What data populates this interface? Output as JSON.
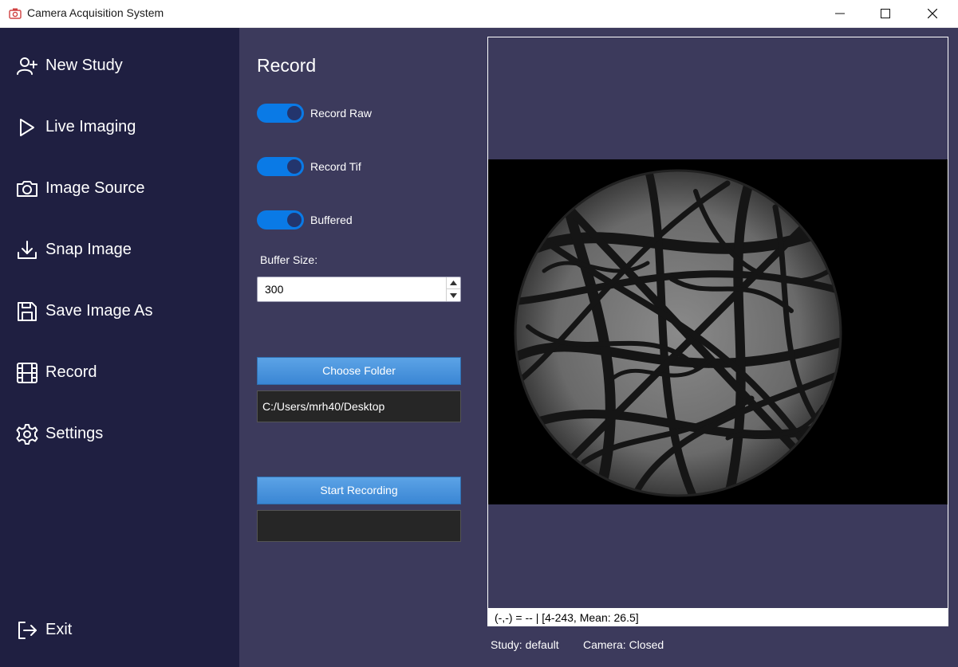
{
  "window": {
    "title": "Camera Acquisition System",
    "icon": "camera-app-icon"
  },
  "sidebar": {
    "items": [
      {
        "label": "New Study",
        "icon": "add-user-icon"
      },
      {
        "label": "Live Imaging",
        "icon": "play-icon"
      },
      {
        "label": "Image Source",
        "icon": "camera-icon"
      },
      {
        "label": "Snap Image",
        "icon": "download-icon"
      },
      {
        "label": "Save Image As",
        "icon": "save-icon"
      },
      {
        "label": "Record",
        "icon": "film-icon"
      },
      {
        "label": "Settings",
        "icon": "gear-icon"
      }
    ],
    "exit": {
      "label": "Exit",
      "icon": "exit-icon"
    }
  },
  "record_panel": {
    "title": "Record",
    "toggles": [
      {
        "label": "Record Raw",
        "on": true
      },
      {
        "label": "Record Tif",
        "on": true
      },
      {
        "label": "Buffered",
        "on": true
      }
    ],
    "buffer_size_label": "Buffer Size:",
    "buffer_size_value": "300",
    "choose_folder_label": "Choose Folder",
    "folder_path": "C:/Users/mrh40/Desktop",
    "start_recording_label": "Start Recording",
    "recording_status": ""
  },
  "viewer": {
    "status_line": "(-,-) = -- | [4-243, Mean: 26.5]",
    "study": "Study: default",
    "camera": "Camera: Closed"
  },
  "colors": {
    "sidebar_bg": "#1f1f41",
    "panel_bg": "#3c3a5c",
    "toggle_on": "#0a7ae6",
    "button": "#4a95dd"
  }
}
